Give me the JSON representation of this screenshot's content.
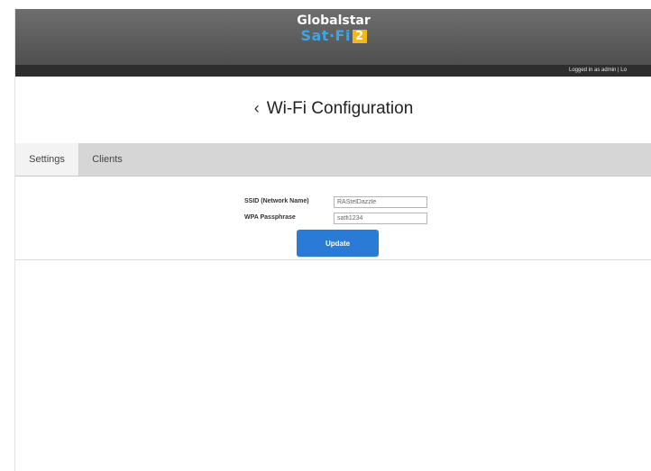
{
  "header": {
    "logo_top": "Globalstar",
    "logo_sat": "Sat",
    "logo_dot": "·",
    "logo_fi": "Fi",
    "logo_badge": "2",
    "login_info": "Logged in as admin | Lo"
  },
  "page": {
    "back_icon": "chevron-left-icon",
    "back_glyph": "‹",
    "title": "Wi-Fi Configuration"
  },
  "tabs": [
    {
      "label": "Settings",
      "active": true
    },
    {
      "label": "Clients",
      "active": false
    }
  ],
  "form": {
    "ssid_label": "SSID (Network Name)",
    "ssid_value": "RAStelDazzle",
    "wpa_label": "WPA Passphrase",
    "wpa_value": "satfi1234",
    "update_label": "Update"
  },
  "colors": {
    "header_bg": "#5a5a5a",
    "subbar_bg": "#2d2d2d",
    "accent_blue": "#2a7bd6",
    "logo_blue": "#3aa6e6",
    "logo_yellow": "#f2b71d",
    "tabs_bg": "#d6d6d6"
  }
}
